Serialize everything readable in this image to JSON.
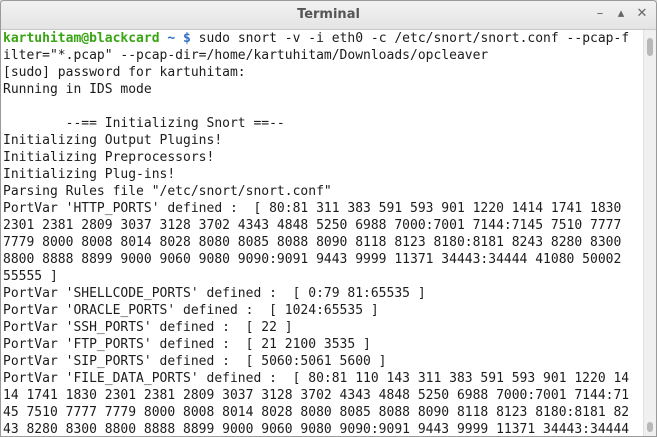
{
  "window": {
    "title": "Terminal",
    "controls": {
      "minimize": "–",
      "maximize": "▴",
      "close": "✕"
    }
  },
  "terminal": {
    "prompt": {
      "user_host": "kartuhitam@blackcard",
      "path": " ~ $",
      "command_part1": " sudo snort -v -i eth0 -c /etc/snort/snort.conf --pcap-f",
      "command_part2": "ilter=\"*.pcap\" --pcap-dir=/home/kartuhitam/Downloads/opcleaver"
    },
    "output_lines": [
      "[sudo] password for kartuhitam:",
      "Running in IDS mode",
      "",
      "        --== Initializing Snort ==--",
      "Initializing Output Plugins!",
      "Initializing Preprocessors!",
      "Initializing Plug-ins!",
      "Parsing Rules file \"/etc/snort/snort.conf\"",
      "PortVar 'HTTP_PORTS' defined :  [ 80:81 311 383 591 593 901 1220 1414 1741 1830",
      "2301 2381 2809 3037 3128 3702 4343 4848 5250 6988 7000:7001 7144:7145 7510 7777",
      "7779 8000 8008 8014 8028 8080 8085 8088 8090 8118 8123 8180:8181 8243 8280 8300",
      "8800 8888 8899 9000 9060 9080 9090:9091 9443 9999 11371 34443:34444 41080 50002",
      "55555 ]",
      "PortVar 'SHELLCODE_PORTS' defined :  [ 0:79 81:65535 ]",
      "PortVar 'ORACLE_PORTS' defined :  [ 1024:65535 ]",
      "PortVar 'SSH_PORTS' defined :  [ 22 ]",
      "PortVar 'FTP_PORTS' defined :  [ 21 2100 3535 ]",
      "PortVar 'SIP_PORTS' defined :  [ 5060:5061 5600 ]",
      "PortVar 'FILE_DATA_PORTS' defined :  [ 80:81 110 143 311 383 591 593 901 1220 14",
      "14 1741 1830 2301 2381 2809 3037 3128 3702 4343 4848 5250 6988 7000:7001 7144:71",
      "45 7510 7777 7779 8000 8008 8014 8028 8080 8085 8088 8090 8118 8123 8180:8181 82",
      "43 8280 8300 8800 8888 8899 9000 9060 9080 9090:9091 9443 9999 11371 34443:34444"
    ]
  },
  "colors": {
    "prompt_user": "#39a513",
    "prompt_path": "#2f6fc6",
    "text": "#1c1c1c",
    "background": "#ffffff"
  }
}
